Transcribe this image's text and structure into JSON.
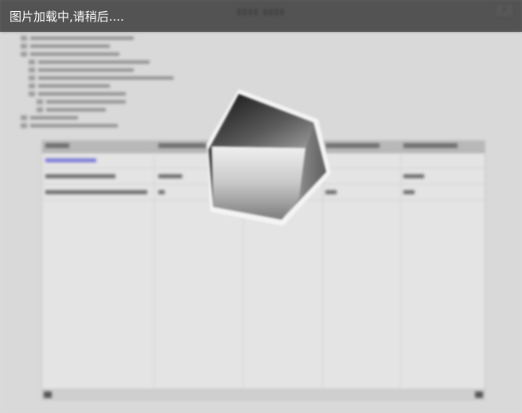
{
  "loading": {
    "message": "图片加载中,请稍后...."
  },
  "colors": {
    "overlay": "#464646",
    "window_bg": "#d9d9d9",
    "link": "#7a7ad8"
  },
  "icons": {
    "loading": "loading-polyhedron-icon",
    "close": "close-icon"
  }
}
